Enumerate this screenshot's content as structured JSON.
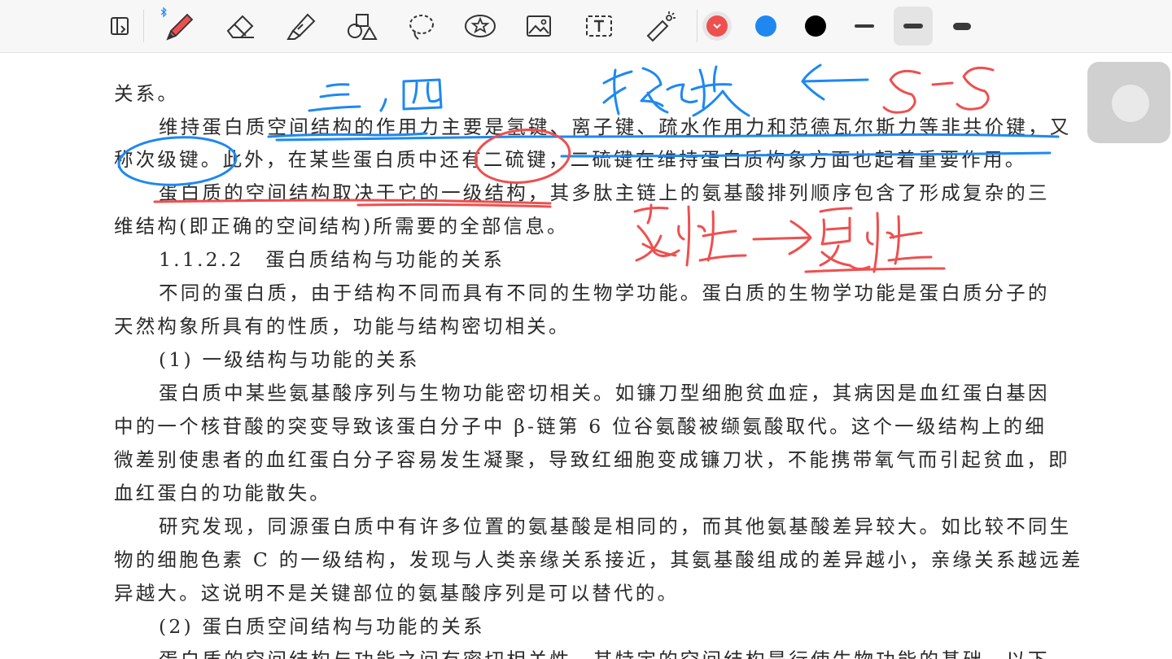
{
  "toolbar": {
    "tools": [
      {
        "name": "page-view-icon"
      },
      {
        "name": "pen-icon",
        "selected": true,
        "badge": "bluetooth-icon"
      },
      {
        "name": "eraser-icon"
      },
      {
        "name": "highlighter-icon"
      },
      {
        "name": "shapes-icon"
      },
      {
        "name": "lasso-icon"
      },
      {
        "name": "sticker-icon"
      },
      {
        "name": "image-icon"
      },
      {
        "name": "text-box-icon"
      },
      {
        "name": "laser-pointer-icon"
      }
    ],
    "colors": [
      {
        "name": "red",
        "hex": "#ee4f4f",
        "selected": true
      },
      {
        "name": "blue",
        "hex": "#1e88f0"
      },
      {
        "name": "black",
        "hex": "#000000"
      }
    ],
    "stroke_sizes": [
      "thin",
      "medium",
      "thick"
    ],
    "selected_stroke": "medium"
  },
  "document": {
    "lines": [
      "关系。",
      "维持蛋白质空间结构的作用力主要是氢键、离子键、疏水作用力和范德瓦尔斯力等非共价键，又",
      "称次级键。此外，在某些蛋白质中还有二硫键，二硫键在维持蛋白质构象方面也起着重要作用。",
      "蛋白质的空间结构取决于它的一级结构，其多肽主链上的氨基酸排列顺序包含了形成复杂的三",
      "维结构(即正确的空间结构)所需要的全部信息。",
      "1.1.2.2　蛋白质结构与功能的关系",
      "不同的蛋白质，由于结构不同而具有不同的生物学功能。蛋白质的生物学功能是蛋白质分子的",
      "天然构象所具有的性质，功能与结构密切相关。",
      "(1) 一级结构与功能的关系",
      "蛋白质中某些氨基酸序列与生物功能密切相关。如镰刀型细胞贫血症，其病因是血红蛋白基因",
      "中的一个核苷酸的突变导致该蛋白分子中 β-链第 6 位谷氨酸被缬氨酸取代。这个一级结构上的细",
      "微差别使患者的血红蛋白分子容易发生凝聚，导致红细胞变成镰刀状，不能携带氧气而引起贫血，即",
      "血红蛋白的功能散失。",
      "研究发现，同源蛋白质中有许多位置的氨基酸是相同的，而其他氨基酸差异较大。如比较不同生",
      "物的细胞色素 C 的一级结构，发现与人类亲缘关系接近，其氨基酸组成的差异越小，亲缘关系越远差",
      "异越大。这说明不是关键部位的氨基酸序列是可以替代的。",
      "(2) 蛋白质空间结构与功能的关系",
      "蛋白质的空间结构与功能之间有密切相关性，其特定的空间结构是行使生物功能的基础。以下"
    ]
  },
  "annotations": {
    "blue_color": "#1e88f0",
    "red_color": "#ee4f4f"
  }
}
